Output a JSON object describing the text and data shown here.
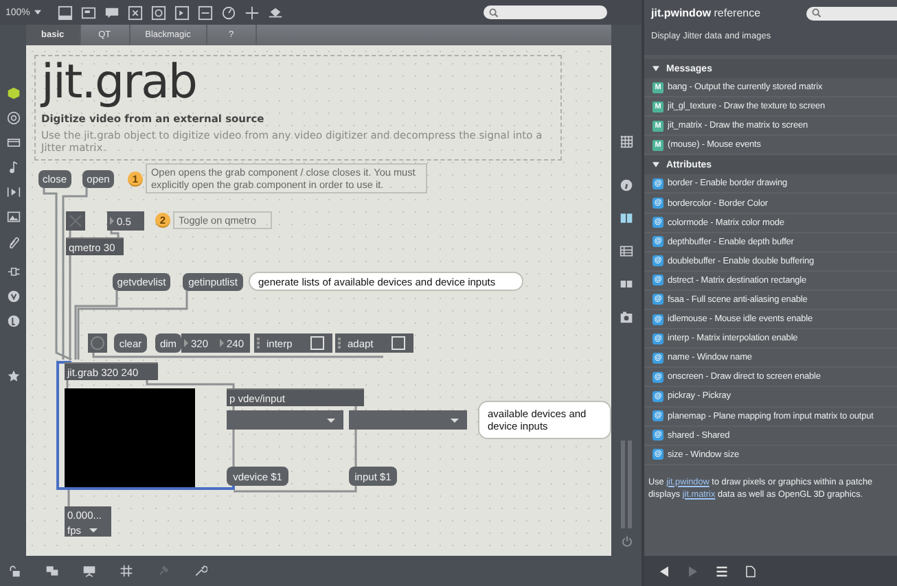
{
  "toolbar": {
    "zoom": "100%"
  },
  "tabs": [
    {
      "label": "basic",
      "selected": true
    },
    {
      "label": "QT",
      "selected": false
    },
    {
      "label": "Blackmagic",
      "selected": false
    },
    {
      "label": "?",
      "selected": false
    }
  ],
  "help": {
    "title": "jit.grab",
    "subtitle": "Digitize video from an external source",
    "description": "Use the jit.grab object to digitize video from any video digitizer and decompress the signal into a Jitter matrix."
  },
  "patch": {
    "objects": [
      {
        "kind": "message",
        "text": "close"
      },
      {
        "kind": "message",
        "text": "open"
      },
      {
        "kind": "badge",
        "text": "1"
      },
      {
        "kind": "comment",
        "text": "Open opens the grab component / close closes it. You must explicitly open the grab component in order to use it."
      },
      {
        "kind": "toggle",
        "checked": false
      },
      {
        "kind": "number",
        "text": "0.5"
      },
      {
        "kind": "badge",
        "text": "2"
      },
      {
        "kind": "comment",
        "text": "Toggle on qmetro"
      },
      {
        "kind": "object",
        "text": "qmetro 30"
      },
      {
        "kind": "message",
        "text": "getvdevlist"
      },
      {
        "kind": "message",
        "text": "getinputlist"
      },
      {
        "kind": "bubble",
        "text": "generate lists of available devices and device inputs"
      },
      {
        "kind": "bang"
      },
      {
        "kind": "message",
        "text": "clear"
      },
      {
        "kind": "message",
        "text": "dim"
      },
      {
        "kind": "number",
        "text": "320"
      },
      {
        "kind": "number",
        "text": "240"
      },
      {
        "kind": "attrui",
        "text": "interp",
        "checked": false
      },
      {
        "kind": "attrui",
        "text": "adapt",
        "checked": false
      },
      {
        "kind": "object",
        "text": "jit.grab 320 240"
      },
      {
        "kind": "pwindow"
      },
      {
        "kind": "object",
        "text": "p vdev/input"
      },
      {
        "kind": "umenu"
      },
      {
        "kind": "umenu"
      },
      {
        "kind": "bubble",
        "text": "available devices and device inputs"
      },
      {
        "kind": "message",
        "text": "vdevice $1"
      },
      {
        "kind": "message",
        "text": "input $1"
      },
      {
        "kind": "readout",
        "text": "0.000..."
      },
      {
        "kind": "menu",
        "text": "fps"
      }
    ]
  },
  "reference": {
    "title": "**jit.pwindow** reference",
    "subtitle": "Display Jitter data and images",
    "sections": [
      {
        "title": "Messages",
        "kind": "message",
        "expanded": true,
        "items": [
          {
            "badge": "M",
            "text": "bang - Output the currently stored matrix"
          },
          {
            "badge": "M",
            "text": "jit_gl_texture - Draw the texture to screen"
          },
          {
            "badge": "M",
            "text": "jit_matrix - Draw the matrix to screen"
          },
          {
            "badge": "M",
            "text": "(mouse) - Mouse events"
          }
        ]
      },
      {
        "title": "Attributes",
        "kind": "attribute",
        "expanded": true,
        "items": [
          {
            "badge": "@",
            "text": "border - Enable border drawing"
          },
          {
            "badge": "@",
            "text": "bordercolor - Border Color"
          },
          {
            "badge": "@",
            "text": "colormode - Matrix color mode"
          },
          {
            "badge": "@",
            "text": "depthbuffer - Enable depth buffer"
          },
          {
            "badge": "@",
            "text": "doublebuffer - Enable double buffering"
          },
          {
            "badge": "@",
            "text": "dstrect - Matrix destination rectangle"
          },
          {
            "badge": "@",
            "text": "fsaa - Full scene anti-aliasing enable"
          },
          {
            "badge": "@",
            "text": "idlemouse - Mouse idle events enable"
          },
          {
            "badge": "@",
            "text": "interp - Matrix interpolation enable"
          },
          {
            "badge": "@",
            "text": "name - Window name"
          },
          {
            "badge": "@",
            "text": "onscreen - Draw direct to screen enable"
          },
          {
            "badge": "@",
            "text": "pickray - Pickray"
          },
          {
            "badge": "@",
            "text": "planemap - Plane mapping from input matrix to output"
          },
          {
            "badge": "@",
            "text": "shared - Shared"
          },
          {
            "badge": "@",
            "text": "size - Window size"
          }
        ]
      }
    ],
    "footer": [
      [
        {
          "text": "Use ",
          "link": false
        },
        {
          "text": "jit.pwindow",
          "link": true
        },
        {
          "text": " to draw pixels or graphics within a patche",
          "link": false
        }
      ],
      [
        {
          "text": "displays ",
          "link": false
        },
        {
          "text": "jit.matrix",
          "link": true
        },
        {
          "text": " data as well as OpenGL 3D graphics.",
          "link": false
        }
      ]
    ]
  }
}
